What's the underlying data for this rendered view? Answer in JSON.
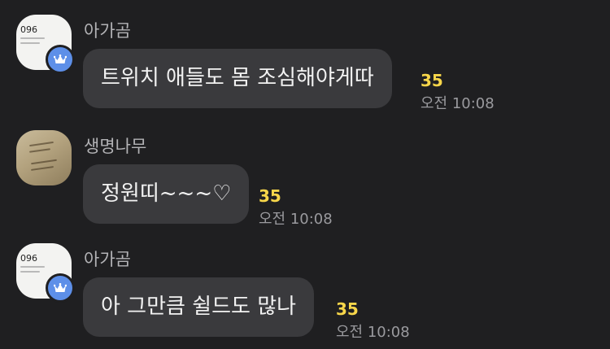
{
  "messages": [
    {
      "sender": "아가곰",
      "avatar_caption": "096",
      "text": "트위치 애들도 몸 조심해야게따",
      "unread": "35",
      "time": "오전 10:08"
    },
    {
      "sender": "생명나무",
      "text": "정원띠~~~♡",
      "unread": "35",
      "time": "오전 10:08"
    },
    {
      "sender": "아가곰",
      "avatar_caption": "096",
      "text": "아 그만큼 쉴드도 많나",
      "unread": "35",
      "time": "오전 10:08"
    }
  ],
  "colors": {
    "background": "#1f1f21",
    "bubble": "#3a3a3d",
    "unread": "#f7d64a",
    "crown_badge": "#5d8fe8"
  },
  "icons": [
    "crown-icon"
  ]
}
